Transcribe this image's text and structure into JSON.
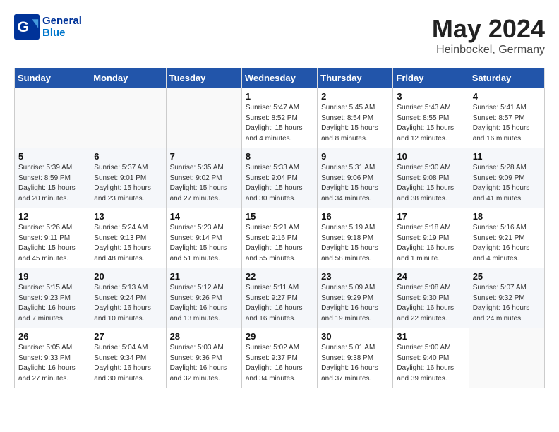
{
  "header": {
    "logo_line1": "General",
    "logo_line2": "Blue",
    "month": "May 2024",
    "location": "Heinbockel, Germany"
  },
  "weekdays": [
    "Sunday",
    "Monday",
    "Tuesday",
    "Wednesday",
    "Thursday",
    "Friday",
    "Saturday"
  ],
  "weeks": [
    [
      {
        "day": "",
        "info": ""
      },
      {
        "day": "",
        "info": ""
      },
      {
        "day": "",
        "info": ""
      },
      {
        "day": "1",
        "info": "Sunrise: 5:47 AM\nSunset: 8:52 PM\nDaylight: 15 hours\nand 4 minutes."
      },
      {
        "day": "2",
        "info": "Sunrise: 5:45 AM\nSunset: 8:54 PM\nDaylight: 15 hours\nand 8 minutes."
      },
      {
        "day": "3",
        "info": "Sunrise: 5:43 AM\nSunset: 8:55 PM\nDaylight: 15 hours\nand 12 minutes."
      },
      {
        "day": "4",
        "info": "Sunrise: 5:41 AM\nSunset: 8:57 PM\nDaylight: 15 hours\nand 16 minutes."
      }
    ],
    [
      {
        "day": "5",
        "info": "Sunrise: 5:39 AM\nSunset: 8:59 PM\nDaylight: 15 hours\nand 20 minutes."
      },
      {
        "day": "6",
        "info": "Sunrise: 5:37 AM\nSunset: 9:01 PM\nDaylight: 15 hours\nand 23 minutes."
      },
      {
        "day": "7",
        "info": "Sunrise: 5:35 AM\nSunset: 9:02 PM\nDaylight: 15 hours\nand 27 minutes."
      },
      {
        "day": "8",
        "info": "Sunrise: 5:33 AM\nSunset: 9:04 PM\nDaylight: 15 hours\nand 30 minutes."
      },
      {
        "day": "9",
        "info": "Sunrise: 5:31 AM\nSunset: 9:06 PM\nDaylight: 15 hours\nand 34 minutes."
      },
      {
        "day": "10",
        "info": "Sunrise: 5:30 AM\nSunset: 9:08 PM\nDaylight: 15 hours\nand 38 minutes."
      },
      {
        "day": "11",
        "info": "Sunrise: 5:28 AM\nSunset: 9:09 PM\nDaylight: 15 hours\nand 41 minutes."
      }
    ],
    [
      {
        "day": "12",
        "info": "Sunrise: 5:26 AM\nSunset: 9:11 PM\nDaylight: 15 hours\nand 45 minutes."
      },
      {
        "day": "13",
        "info": "Sunrise: 5:24 AM\nSunset: 9:13 PM\nDaylight: 15 hours\nand 48 minutes."
      },
      {
        "day": "14",
        "info": "Sunrise: 5:23 AM\nSunset: 9:14 PM\nDaylight: 15 hours\nand 51 minutes."
      },
      {
        "day": "15",
        "info": "Sunrise: 5:21 AM\nSunset: 9:16 PM\nDaylight: 15 hours\nand 55 minutes."
      },
      {
        "day": "16",
        "info": "Sunrise: 5:19 AM\nSunset: 9:18 PM\nDaylight: 15 hours\nand 58 minutes."
      },
      {
        "day": "17",
        "info": "Sunrise: 5:18 AM\nSunset: 9:19 PM\nDaylight: 16 hours\nand 1 minute."
      },
      {
        "day": "18",
        "info": "Sunrise: 5:16 AM\nSunset: 9:21 PM\nDaylight: 16 hours\nand 4 minutes."
      }
    ],
    [
      {
        "day": "19",
        "info": "Sunrise: 5:15 AM\nSunset: 9:23 PM\nDaylight: 16 hours\nand 7 minutes."
      },
      {
        "day": "20",
        "info": "Sunrise: 5:13 AM\nSunset: 9:24 PM\nDaylight: 16 hours\nand 10 minutes."
      },
      {
        "day": "21",
        "info": "Sunrise: 5:12 AM\nSunset: 9:26 PM\nDaylight: 16 hours\nand 13 minutes."
      },
      {
        "day": "22",
        "info": "Sunrise: 5:11 AM\nSunset: 9:27 PM\nDaylight: 16 hours\nand 16 minutes."
      },
      {
        "day": "23",
        "info": "Sunrise: 5:09 AM\nSunset: 9:29 PM\nDaylight: 16 hours\nand 19 minutes."
      },
      {
        "day": "24",
        "info": "Sunrise: 5:08 AM\nSunset: 9:30 PM\nDaylight: 16 hours\nand 22 minutes."
      },
      {
        "day": "25",
        "info": "Sunrise: 5:07 AM\nSunset: 9:32 PM\nDaylight: 16 hours\nand 24 minutes."
      }
    ],
    [
      {
        "day": "26",
        "info": "Sunrise: 5:05 AM\nSunset: 9:33 PM\nDaylight: 16 hours\nand 27 minutes."
      },
      {
        "day": "27",
        "info": "Sunrise: 5:04 AM\nSunset: 9:34 PM\nDaylight: 16 hours\nand 30 minutes."
      },
      {
        "day": "28",
        "info": "Sunrise: 5:03 AM\nSunset: 9:36 PM\nDaylight: 16 hours\nand 32 minutes."
      },
      {
        "day": "29",
        "info": "Sunrise: 5:02 AM\nSunset: 9:37 PM\nDaylight: 16 hours\nand 34 minutes."
      },
      {
        "day": "30",
        "info": "Sunrise: 5:01 AM\nSunset: 9:38 PM\nDaylight: 16 hours\nand 37 minutes."
      },
      {
        "day": "31",
        "info": "Sunrise: 5:00 AM\nSunset: 9:40 PM\nDaylight: 16 hours\nand 39 minutes."
      },
      {
        "day": "",
        "info": ""
      }
    ]
  ]
}
